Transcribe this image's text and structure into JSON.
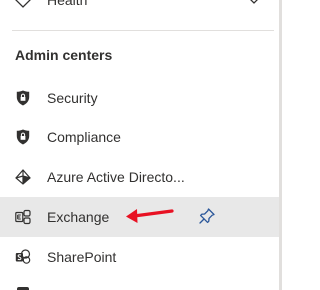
{
  "nav": {
    "top_item": {
      "label": "Health",
      "icon": "health-icon"
    },
    "section_title": "Admin centers",
    "items": [
      {
        "label": "Security",
        "icon": "shield-icon"
      },
      {
        "label": "Compliance",
        "icon": "shield-icon"
      },
      {
        "label": "Azure Active Directo...",
        "icon": "azure-ad-icon"
      },
      {
        "label": "Exchange",
        "icon": "exchange-icon",
        "selected": true
      },
      {
        "label": "SharePoint",
        "icon": "sharepoint-icon"
      }
    ]
  },
  "colors": {
    "text": "#323130",
    "selected_bg": "#e8e8e8",
    "pin": "#2b579a",
    "annotation_arrow": "#e81123"
  }
}
